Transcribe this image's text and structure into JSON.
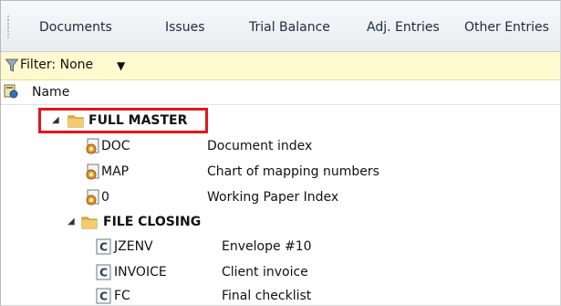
{
  "tabs": [
    "Documents",
    "Issues",
    "Trial Balance",
    "Adj. Entries",
    "Other Entries"
  ],
  "filter": {
    "label": "Filter: None",
    "dropdown_icon": "dropdown-arrow-icon"
  },
  "header": {
    "column_name": "Name",
    "icon": "properties-icon"
  },
  "tree": {
    "root": {
      "label": "FULL MASTER",
      "expanded": true,
      "highlight_color": "#e3161c"
    },
    "root_items": [
      {
        "code": "DOC",
        "description": "Document index"
      },
      {
        "code": "MAP",
        "description": "Chart of mapping numbers"
      },
      {
        "code": "0",
        "description": "Working Paper Index"
      }
    ],
    "subfolder": {
      "label": "FILE CLOSING",
      "expanded": true
    },
    "subfolder_items": [
      {
        "code": "JZENV",
        "description": "Envelope #10"
      },
      {
        "code": "INVOICE",
        "description": "Client invoice"
      },
      {
        "code": "FC",
        "description": "Final checklist"
      }
    ]
  },
  "colors": {
    "filter_bg": "#fff9cf",
    "folder": "#e8b54a",
    "highlight": "#e3161c"
  }
}
